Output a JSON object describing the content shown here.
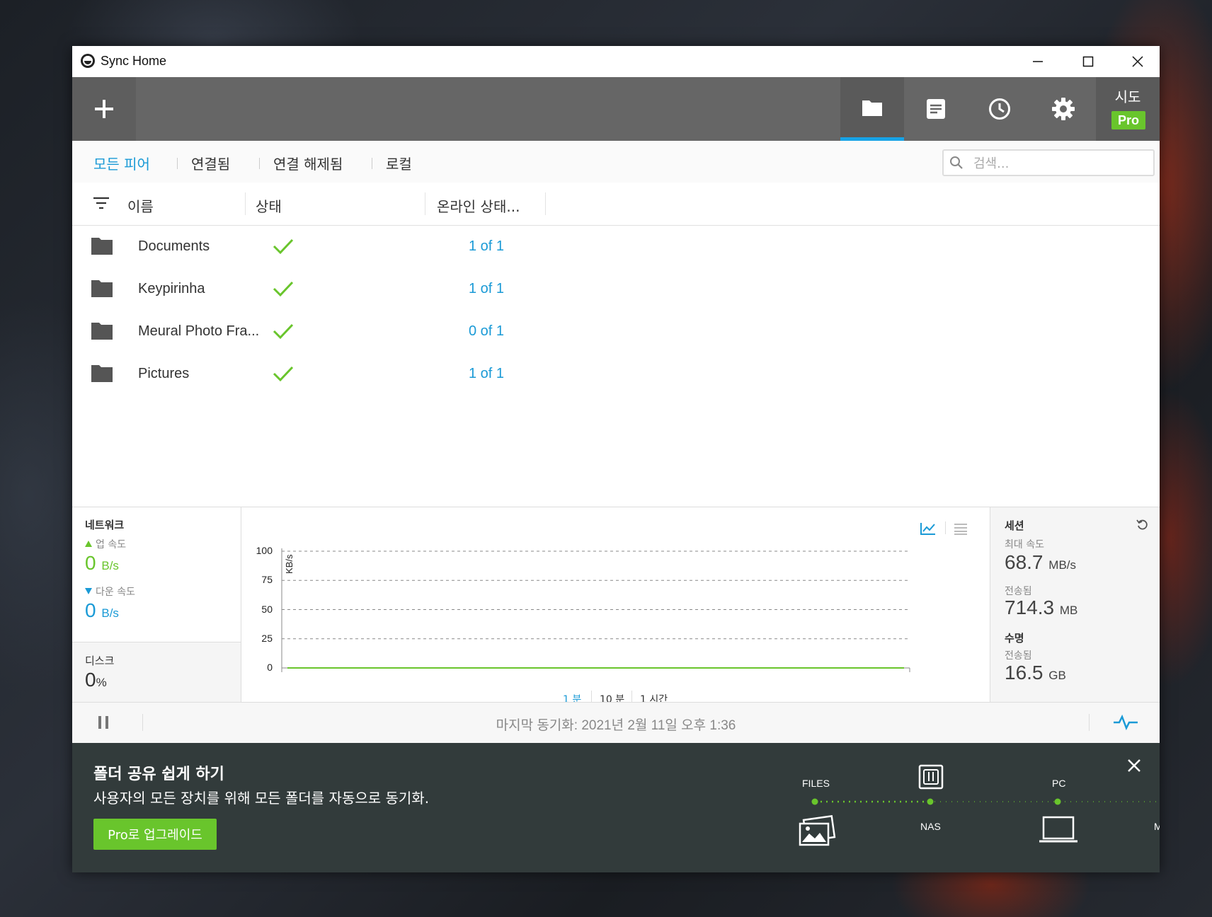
{
  "window": {
    "title": "Sync Home"
  },
  "toolbar": {
    "user_name": "시도",
    "pro_badge": "Pro"
  },
  "tabs": [
    "모든 피어",
    "연결됨",
    "연결 해제됨",
    "로컬"
  ],
  "search": {
    "placeholder": "검색..."
  },
  "table": {
    "headers": {
      "name": "이름",
      "status": "상태",
      "online": "온라인 상태..."
    },
    "rows": [
      {
        "name": "Documents",
        "online": "1 of 1"
      },
      {
        "name": "Keypirinha",
        "online": "1 of 1"
      },
      {
        "name": "Meural Photo Fra...",
        "online": "0 of 1"
      },
      {
        "name": "Pictures",
        "online": "1 of 1"
      }
    ]
  },
  "network": {
    "title": "네트워크",
    "up_label": "업 속도",
    "up_value": "0",
    "up_unit": "B/s",
    "down_label": "다운 속도",
    "down_value": "0",
    "down_unit": "B/s"
  },
  "disk": {
    "title": "디스크",
    "value": "0",
    "unit": "%"
  },
  "chart_data": {
    "type": "line",
    "ylabel": "KB/s",
    "yticks": [
      "100",
      "75",
      "50",
      "25",
      "0"
    ],
    "ylim": [
      0,
      100
    ],
    "series": [
      {
        "values": [
          0,
          0
        ]
      }
    ],
    "ranges": [
      "1 분",
      "10 분",
      "1 시간"
    ],
    "active_range": "1 분"
  },
  "session": {
    "title": "세션",
    "max_speed_label": "최대 속도",
    "max_speed_value": "68.7",
    "max_speed_unit": "MB/s",
    "transferred_label": "전송됨",
    "transferred_value": "714.3",
    "transferred_unit": "MB"
  },
  "lifetime": {
    "title": "수명",
    "transferred_label": "전송됨",
    "transferred_value": "16.5",
    "transferred_unit": "GB"
  },
  "status": {
    "last_sync": "마지막 동기화: 2021년 2월 11일 오후 1:36"
  },
  "promo": {
    "title": "폴더 공유 쉽게 하기",
    "subtitle": "사용자의 모든 장치를 위해 모든 폴더를 자동으로 동기화.",
    "button": "Pro로 업그레이드",
    "labels": {
      "files": "FILES",
      "nas": "NAS",
      "pc": "PC",
      "mobile": "MOBILE"
    }
  },
  "colors": {
    "accent": "#1a9ad6",
    "green": "#69c52c",
    "toolbar": "#666666",
    "promo_bg": "#323b3b"
  }
}
